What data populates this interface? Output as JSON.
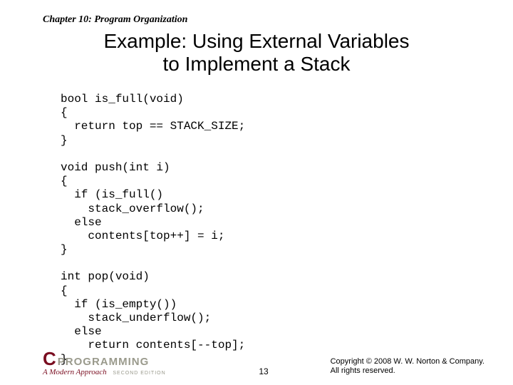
{
  "chapter": "Chapter 10: Program Organization",
  "title_line1": "Example: Using External Variables",
  "title_line2": "to Implement a Stack",
  "code": "bool is_full(void)\n{\n  return top == STACK_SIZE;\n}\n\nvoid push(int i)\n{\n  if (is_full()\n    stack_overflow();\n  else\n    contents[top++] = i;\n}\n\nint pop(void)\n{\n  if (is_empty())\n    stack_underflow();\n  else\n    return contents[--top];\n}",
  "logo": {
    "c": "C",
    "word": "PROGRAMMING",
    "subtitle": "A Modern Approach",
    "edition": "SECOND EDITION"
  },
  "page_number": "13",
  "copyright_line1": "Copyright © 2008 W. W. Norton & Company.",
  "copyright_line2": "All rights reserved."
}
